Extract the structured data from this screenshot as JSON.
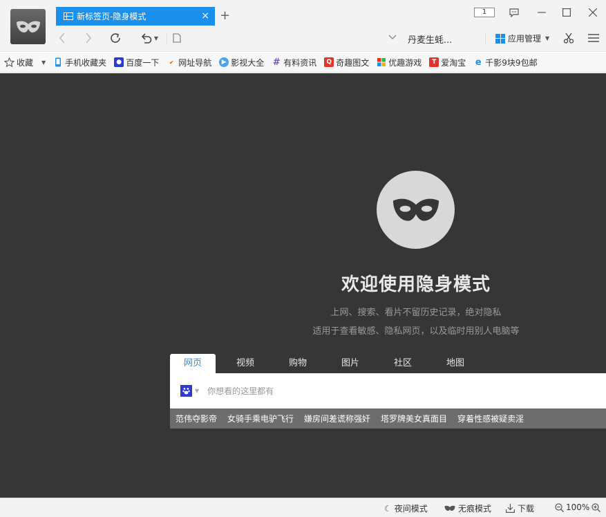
{
  "tab": {
    "title": "新标签页-隐身模式",
    "close": "×"
  },
  "new_tab": "+",
  "window": {
    "tab_count": "1"
  },
  "address_bar": {
    "hot_search": "丹麦生蚝..."
  },
  "apps": {
    "label": "应用管理"
  },
  "bookmarks": [
    {
      "label": "收藏",
      "icon": "star-icon"
    },
    {
      "label": "手机收藏夹",
      "icon": "phone-icon",
      "color": "#1a90ec"
    },
    {
      "label": "百度一下",
      "icon": "baidu-icon",
      "color": "#2a3bd1"
    },
    {
      "label": "网址导航",
      "icon": "hao-icon",
      "color": "#e05a00"
    },
    {
      "label": "影视大全",
      "icon": "video-icon",
      "color": "#4aa3e8"
    },
    {
      "label": "有料资讯",
      "icon": "news-icon",
      "color": "#6a5acd"
    },
    {
      "label": "奇趣图文",
      "icon": "qu-icon",
      "color": "#e0352b"
    },
    {
      "label": "优趣游戏",
      "icon": "game-icon",
      "color": "#3cb44b"
    },
    {
      "label": "爱淘宝",
      "icon": "taobao-icon",
      "color": "#e0352b"
    },
    {
      "label": "千影9块9包邮",
      "icon": "ie-icon",
      "color": "#1a90ec"
    }
  ],
  "welcome": {
    "title": "欢迎使用隐身模式",
    "sub1": "上网、搜索、看片不留历史记录，绝对隐私",
    "sub2": "适用于查看敏感、隐私网页，以及临时用别人电脑等"
  },
  "search": {
    "tabs": [
      "网页",
      "视频",
      "购物",
      "图片",
      "社区",
      "地图"
    ],
    "active_tab": "网页",
    "placeholder": "你想看的这里都有",
    "hot": [
      "范伟夺影帝",
      "女骑手乘电驴飞行",
      "嫌房间差谎称强奸",
      "塔罗牌美女真面目",
      "穿着性感被疑卖淫"
    ]
  },
  "status": {
    "night_mode": "夜间模式",
    "no_trace": "无痕模式",
    "download": "下载",
    "zoom": "100%"
  },
  "colors": {
    "accent": "#1a90ec",
    "content_bg": "#363636"
  }
}
